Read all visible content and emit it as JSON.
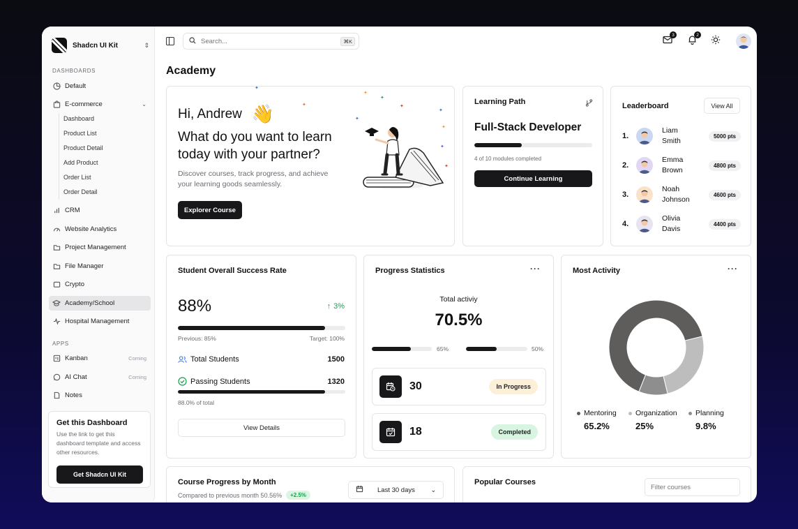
{
  "brand": {
    "name": "Shadcn UI Kit"
  },
  "sidebar": {
    "section_dashboards": "DASHBOARDS",
    "section_apps": "APPS",
    "default": "Default",
    "ecommerce": "E-commerce",
    "ecommerce_sub": [
      "Dashboard",
      "Product List",
      "Product Detail",
      "Add Product",
      "Order List",
      "Order Detail"
    ],
    "crm": "CRM",
    "website_analytics": "Website Analytics",
    "project_management": "Project Management",
    "file_manager": "File Manager",
    "crypto": "Crypto",
    "academy": "Academy/School",
    "hospital": "Hospital Management",
    "kanban": "Kanban",
    "ai_chat": "AI Chat",
    "notes": "Notes",
    "coming": "Coming"
  },
  "promo": {
    "title": "Get this Dashboard",
    "text": "Use the link to get this dashboard template and access other resources.",
    "button": "Get Shadcn UI Kit"
  },
  "topbar": {
    "search_placeholder": "Search...",
    "shortcut": "⌘K",
    "mail_count": "3",
    "notif_count": "2"
  },
  "page": {
    "title": "Academy"
  },
  "hero": {
    "greeting": "Hi, Andrew",
    "headline_1": "What do you want to learn",
    "headline_2": "today with your partner?",
    "desc_1": "Discover courses, track progress, and achieve",
    "desc_2": "your learning goods seamlessly.",
    "button": "Explorer Course"
  },
  "learning_path": {
    "title": "Learning Path",
    "course": "Full-Stack Developer",
    "progress": 0.4,
    "caption": "4 of 10 modules completed",
    "button": "Continue Learning"
  },
  "leaderboard": {
    "title": "Leaderboard",
    "view_all": "View All",
    "rows": [
      {
        "rank": "1.",
        "first": "Liam",
        "last": "Smith",
        "pts": "5000 pts",
        "color": "#c9d7f0"
      },
      {
        "rank": "2.",
        "first": "Emma",
        "last": "Brown",
        "pts": "4800 pts",
        "color": "#e2d6f5"
      },
      {
        "rank": "3.",
        "first": "Noah",
        "last": "Johnson",
        "pts": "4600 pts",
        "color": "#f9e2c9"
      },
      {
        "rank": "4.",
        "first": "Olivia",
        "last": "Davis",
        "pts": "4400 pts",
        "color": "#e7e3f1"
      }
    ]
  },
  "success": {
    "title": "Student Overall Success Rate",
    "value": "88%",
    "change": "3%",
    "progress": 0.88,
    "previous": "Previous: 85%",
    "target": "Target: 100%",
    "total_label": "Total Students",
    "total_value": "1500",
    "passing_label": "Passing Students",
    "passing_value": "1320",
    "passing_progress": 0.88,
    "passing_caption": "88.0% of total",
    "button": "View Details"
  },
  "progress_stats": {
    "title": "Progress Statistics",
    "total_label": "Total activiy",
    "total_value": "70.5%",
    "bar1_label": "65%",
    "bar1": 0.65,
    "bar2_label": "50%",
    "bar2": 0.5,
    "in_progress_count": "30",
    "in_progress_label": "In Progress",
    "completed_count": "18",
    "completed_label": "Completed"
  },
  "most_activity": {
    "title": "Most Activity",
    "legend": [
      {
        "label": "Mentoring",
        "value": "65.2%",
        "color": "#5f5d5c"
      },
      {
        "label": "Organization",
        "value": "25%",
        "color": "#bdbdbd"
      },
      {
        "label": "Planning",
        "value": "9.8%",
        "color": "#8e8e8e"
      }
    ]
  },
  "chart_data": {
    "type": "pie",
    "categories": [
      "Mentoring",
      "Organization",
      "Planning"
    ],
    "values": [
      65.2,
      25,
      9.8
    ],
    "title": "Most Activity"
  },
  "course_progress": {
    "title": "Course Progress by Month",
    "subtitle": "Compared to previous month 50.56%",
    "change": "+2.5%",
    "range": "Last 30 days"
  },
  "popular": {
    "title": "Popular Courses",
    "filter_placeholder": "Filter courses"
  }
}
